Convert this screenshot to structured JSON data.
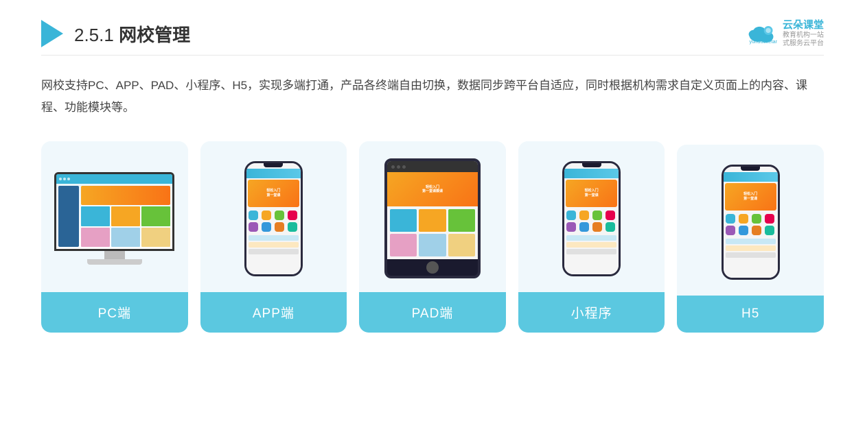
{
  "header": {
    "section_number": "2.5.1",
    "title_plain": "网校管理",
    "brand_name": "云朵课堂",
    "brand_url": "yunduoketang.com",
    "brand_slogan_line1": "教育机构一站",
    "brand_slogan_line2": "式服务云平台"
  },
  "description": {
    "text": "网校支持PC、APP、PAD、小程序、H5，实现多端打通，产品各终端自由切换，数据同步跨平台自适应，同时根据机构需求自定义页面上的内容、课程、功能模块等。"
  },
  "cards": [
    {
      "id": "pc",
      "label": "PC端"
    },
    {
      "id": "app",
      "label": "APP端"
    },
    {
      "id": "pad",
      "label": "PAD端"
    },
    {
      "id": "mini",
      "label": "小程序"
    },
    {
      "id": "h5",
      "label": "H5"
    }
  ],
  "banner_text": {
    "line1": "轻松入门",
    "line2": "第一堂课模课"
  }
}
